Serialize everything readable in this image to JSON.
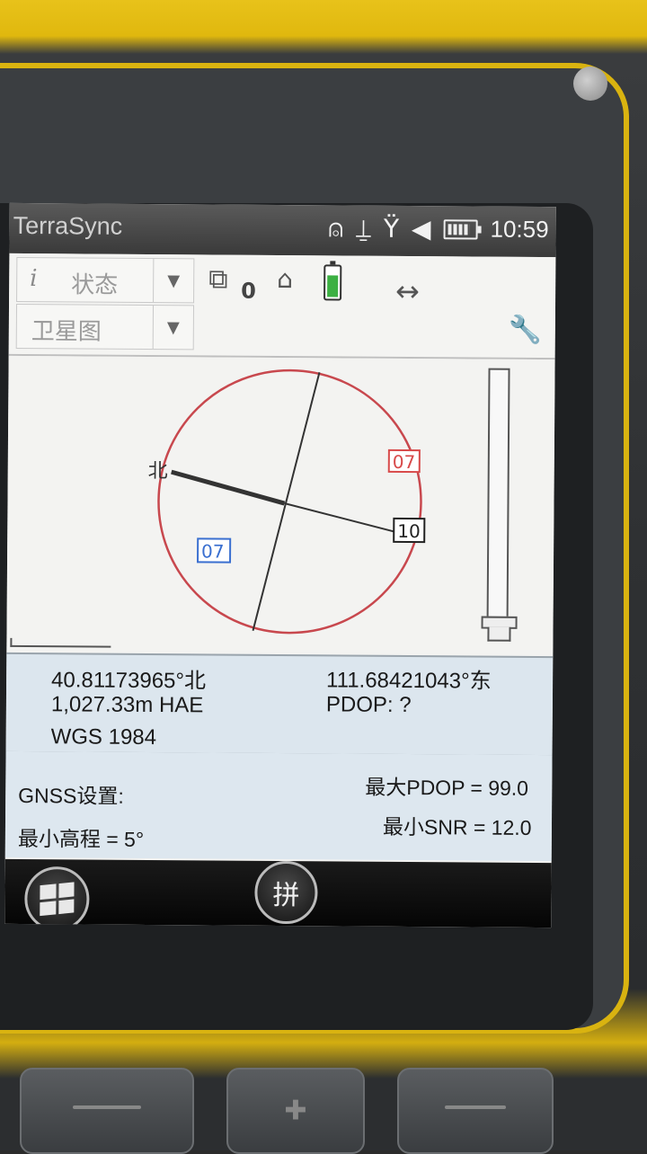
{
  "status_bar": {
    "app_title": "TerraSync",
    "time": "10:59",
    "icons": [
      "antenna-icon",
      "gps-receiver-icon",
      "signal-x-icon",
      "speaker-muted-icon",
      "battery-icon"
    ]
  },
  "toolbar": {
    "section_dropdown_label": "状态",
    "view_dropdown_label": "卫星图",
    "satellite_count": "0"
  },
  "skyplot": {
    "north_label": "北",
    "satellites": [
      "07",
      "10",
      "07"
    ]
  },
  "position": {
    "latitude": "40.81173965°北",
    "longitude": "111.68421043°东",
    "height": "1,027.33m HAE",
    "pdop": "PDOP: ?",
    "datum": "WGS 1984"
  },
  "gnss_settings": {
    "title": "GNSS设置:",
    "max_pdop": "最大PDOP = 99.0",
    "min_elevation": "最小高程 = 5°",
    "min_snr": "最小SNR = 12.0"
  },
  "taskbar": {
    "ime_label": "拼"
  },
  "colors": {
    "sky_circle": "#c8484e",
    "sat_red": "#d84a4a",
    "sat_blue": "#3a6fd0",
    "sat_black": "#222222",
    "panel_bg": "#dce6ee"
  }
}
